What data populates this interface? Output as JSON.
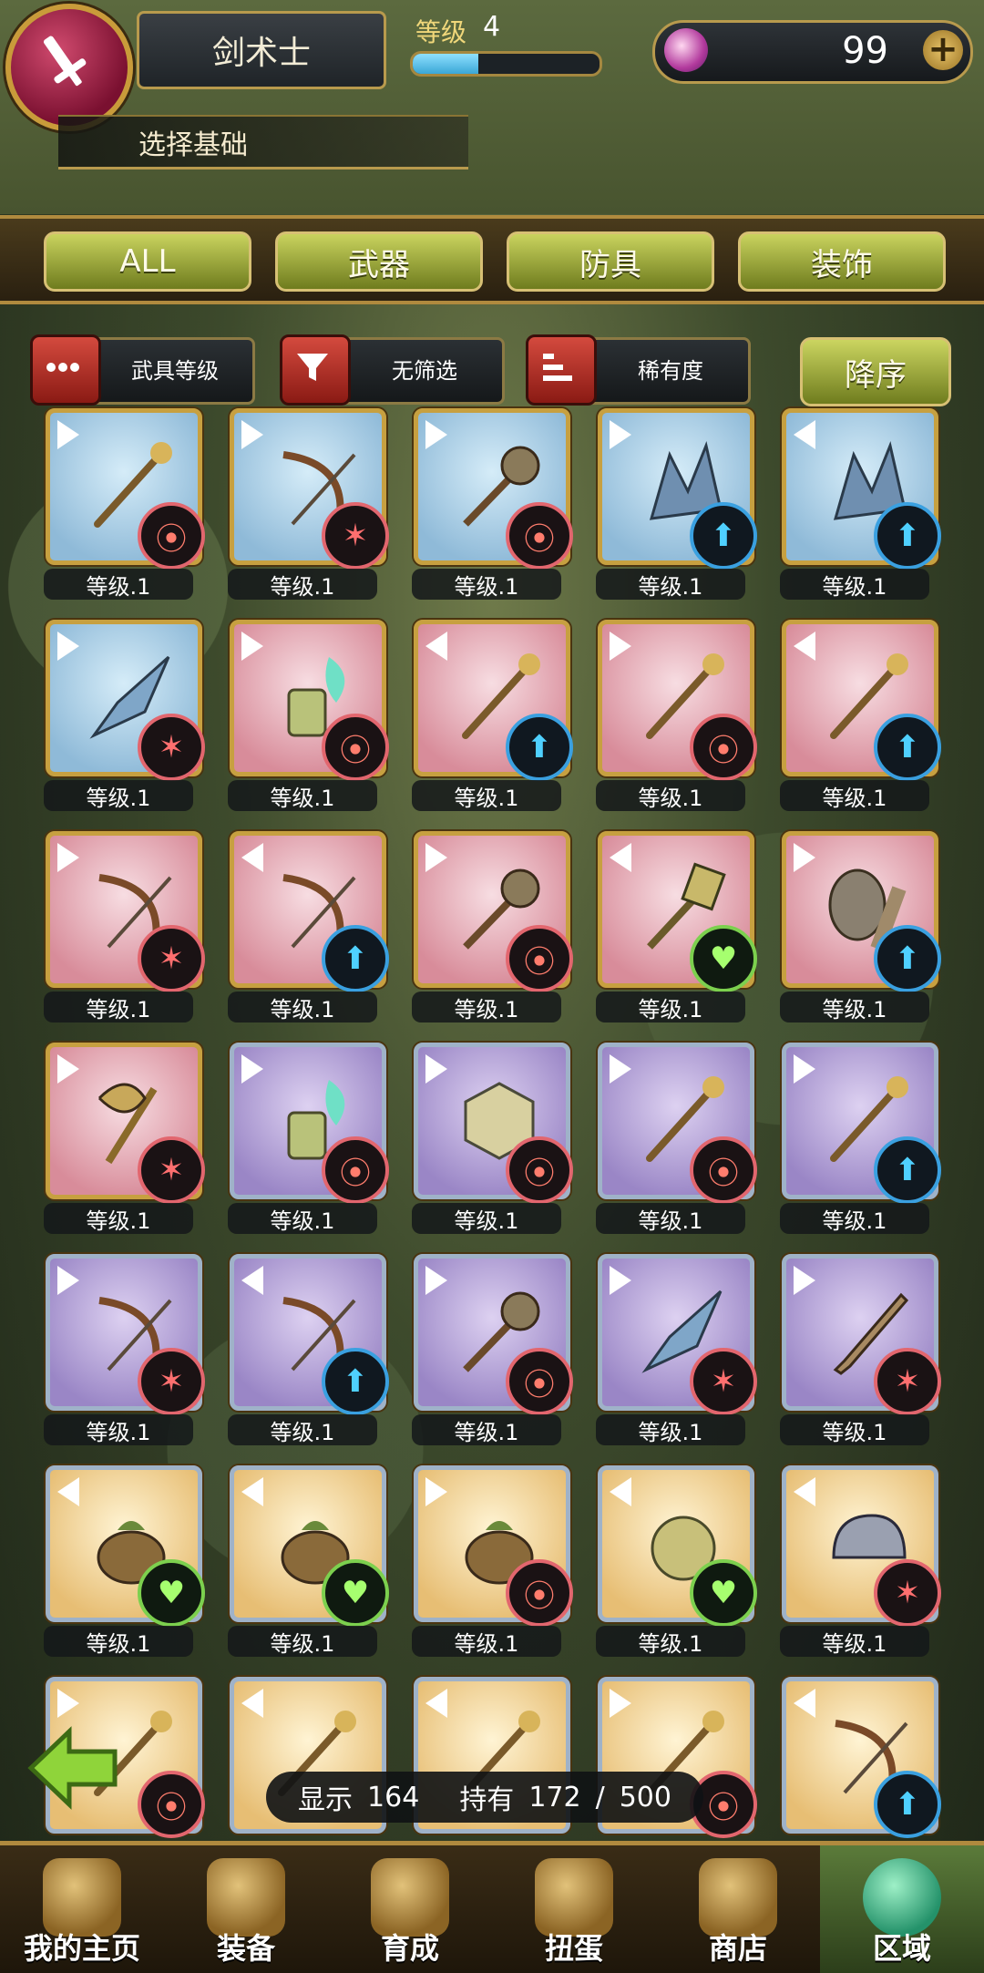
{
  "header": {
    "job": "剑术士",
    "level_label": "等级",
    "level": "4",
    "xp_fraction": 0.35,
    "gems": "99",
    "plus": "+",
    "select_base": "选择基础"
  },
  "tabs": [
    "ALL",
    "武器",
    "防具",
    "装饰"
  ],
  "filters": {
    "level_sort": "武具等级",
    "filter": "无筛选",
    "rarity": "稀有度",
    "order": "降序"
  },
  "items": [
    {
      "level": "等级.1",
      "frame": "blue",
      "badge": "swirl",
      "corner": "r",
      "icon": "staff-icon"
    },
    {
      "level": "等级.1",
      "frame": "blue",
      "badge": "fire",
      "corner": "r",
      "icon": "bow-icon"
    },
    {
      "level": "等级.1",
      "frame": "blue",
      "badge": "swirl",
      "corner": "r",
      "icon": "mace-icon"
    },
    {
      "level": "等级.1",
      "frame": "blue",
      "badge": "up",
      "corner": "r",
      "icon": "crystal-icon"
    },
    {
      "level": "等级.1",
      "frame": "blue",
      "badge": "up",
      "corner": "l",
      "icon": "crystal-icon"
    },
    {
      "level": "等级.1",
      "frame": "blue",
      "badge": "fire",
      "corner": "r",
      "icon": "blade-icon"
    },
    {
      "level": "等级.1",
      "frame": "pink",
      "badge": "swirl",
      "corner": "r",
      "icon": "lantern-icon"
    },
    {
      "level": "等级.1",
      "frame": "pink",
      "badge": "up",
      "corner": "l",
      "icon": "staff-icon"
    },
    {
      "level": "等级.1",
      "frame": "pink",
      "badge": "swirl",
      "corner": "r",
      "icon": "staff-icon"
    },
    {
      "level": "等级.1",
      "frame": "pink",
      "badge": "up",
      "corner": "l",
      "icon": "staff-icon"
    },
    {
      "level": "等级.1",
      "frame": "pink",
      "badge": "fire",
      "corner": "r",
      "icon": "bow-icon"
    },
    {
      "level": "等级.1",
      "frame": "pink",
      "badge": "up",
      "corner": "l",
      "icon": "bow-icon"
    },
    {
      "level": "等级.1",
      "frame": "pink",
      "badge": "swirl",
      "corner": "r",
      "icon": "mace-icon"
    },
    {
      "level": "等级.1",
      "frame": "pink",
      "badge": "heart",
      "corner": "l",
      "icon": "hammer-icon"
    },
    {
      "level": "等级.1",
      "frame": "pink",
      "badge": "up",
      "corner": "r",
      "icon": "club-icon"
    },
    {
      "level": "等级.1",
      "frame": "pink",
      "badge": "fire",
      "corner": "r",
      "icon": "axe-icon"
    },
    {
      "level": "等级.1",
      "frame": "purple",
      "badge": "swirl",
      "corner": "r",
      "icon": "lantern-icon"
    },
    {
      "level": "等级.1",
      "frame": "purple",
      "badge": "swirl",
      "corner": "r",
      "icon": "cube-icon"
    },
    {
      "level": "等级.1",
      "frame": "purple",
      "badge": "swirl",
      "corner": "r",
      "icon": "staff-icon"
    },
    {
      "level": "等级.1",
      "frame": "purple",
      "badge": "up",
      "corner": "r",
      "icon": "staff-icon"
    },
    {
      "level": "等级.1",
      "frame": "purple",
      "badge": "fire",
      "corner": "r",
      "icon": "bow-icon"
    },
    {
      "level": "等级.1",
      "frame": "purple",
      "badge": "up",
      "corner": "l",
      "icon": "bow-icon"
    },
    {
      "level": "等级.1",
      "frame": "purple",
      "badge": "swirl",
      "corner": "r",
      "icon": "mace-icon"
    },
    {
      "level": "等级.1",
      "frame": "purple",
      "badge": "fire",
      "corner": "r",
      "icon": "blade-icon"
    },
    {
      "level": "等级.1",
      "frame": "purple",
      "badge": "fire",
      "corner": "r",
      "icon": "sword-icon"
    },
    {
      "level": "等级.1",
      "frame": "gold",
      "badge": "heart",
      "corner": "l",
      "icon": "pouch-icon"
    },
    {
      "level": "等级.1",
      "frame": "gold",
      "badge": "heart",
      "corner": "l",
      "icon": "pouch-icon"
    },
    {
      "level": "等级.1",
      "frame": "gold",
      "badge": "swirl",
      "corner": "r",
      "icon": "pouch-icon"
    },
    {
      "level": "等级.1",
      "frame": "gold",
      "badge": "heart",
      "corner": "l",
      "icon": "orb-icon"
    },
    {
      "level": "等级.1",
      "frame": "gold",
      "badge": "fire",
      "corner": "l",
      "icon": "helmet-icon"
    },
    {
      "level": "",
      "frame": "gold",
      "badge": "swirl",
      "corner": "r",
      "icon": "staff-icon"
    },
    {
      "level": "",
      "frame": "gold",
      "badge": "",
      "corner": "l",
      "icon": "staff-icon"
    },
    {
      "level": "",
      "frame": "gold",
      "badge": "",
      "corner": "l",
      "icon": "staff-icon"
    },
    {
      "level": "",
      "frame": "gold",
      "badge": "swirl",
      "corner": "r",
      "icon": "staff-icon"
    },
    {
      "level": "",
      "frame": "gold",
      "badge": "up",
      "corner": "l",
      "icon": "bow-icon"
    }
  ],
  "count": {
    "shown_label": "显示",
    "shown": "164",
    "owned_label": "持有",
    "owned": "172",
    "sep": "/",
    "max": "500"
  },
  "nav": [
    {
      "label": "我的主页",
      "icon": "scroll-icon"
    },
    {
      "label": "装备",
      "icon": "helmet-icon"
    },
    {
      "label": "育成",
      "icon": "crossed-swords-icon"
    },
    {
      "label": "扭蛋",
      "icon": "gacha-icon"
    },
    {
      "label": "商店",
      "icon": "shop-icon"
    },
    {
      "label": "区域",
      "icon": "globe-icon"
    }
  ],
  "colors": {
    "accent": "#c7a040",
    "tab": "#9aa83a"
  }
}
